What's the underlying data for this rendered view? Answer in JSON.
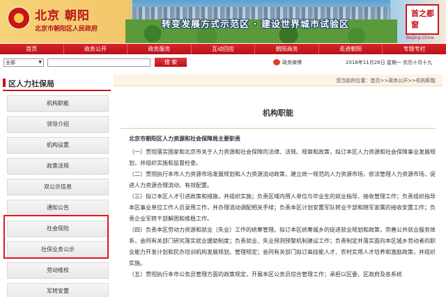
{
  "header": {
    "site_title": "北京 朝阳",
    "site_subtitle": "北京市朝阳区人民政府",
    "slogan": "转变发展方式示范区 · 建设世界城市试验区",
    "seal_text": "首之都窗",
    "seal_caption": "Beijing-China"
  },
  "nav": {
    "items": [
      "首页",
      "政务公开",
      "政务服务",
      "互动回应",
      "朝阳商务",
      "走进朝阳",
      "专题专栏"
    ]
  },
  "search": {
    "select_value": "全部",
    "button_label": "搜 索",
    "weibo_label": "政务微博",
    "date": "2018年11月26日 星期一 农历十月十九"
  },
  "sidebar": {
    "title": "区人力社保局",
    "items": [
      "机构职能",
      "领导介绍",
      "机构设置",
      "政策法规",
      "双公示信息",
      "通知公告",
      "社会保险",
      "社保业务公示",
      "劳动维权",
      "军转安置"
    ]
  },
  "breadcrumb": "您当前的位置：首页>>政务公开>>机构职能",
  "main": {
    "page_title": "机构职能",
    "heading": "北京市朝阳区人力资源和社会保障局主要职责",
    "paragraphs": [
      "（一）贯彻落实国家和北京市关于人力资源和社会保障的法律、法规、规章和政策，拟订本区人力资源和社会保障事业发展规划，并组织实施和监督检查。",
      "（二）贯彻执行本市人力资源市场发展规划和人力资源流动政策，建立统一规范的人力资源市场，依法管理人力资源市场，促进人力资源合理流动、有效配置。",
      "（三）拟订本区人才引进政策和措施，并组织实施；负责区域内用人单位与毕业生的就业指导、接收管理工作；负责组织指导本区事业单位工作人员录用工作，并办理流动调配相关手续；负责本区计划安置军队转业干部和随军家属的接收安置工作；负责企业军转干部解困和维稳工作。",
      "（四）负责本区劳动力资源和就业（失业）工作的统筹管理。拟订本区统筹城乡的促进就业规划和政策，完善公共就业服务体系，会同有关部门研究落实就业援助制度；负责就业、失业预测预警机制建设工作；负责制定并落实面向本区城乡劳动者的职业能力开发计划和民办培训机构发展规划、管理规定；会同有关部门拟订高技能人才、农村实用人才培养和激励政策，并组织实施。",
      "（五）贯彻执行本市公务员管理方面的政策规定，开展本区公务员综合管理工作；承担以区委、区政府及各系统"
    ]
  }
}
